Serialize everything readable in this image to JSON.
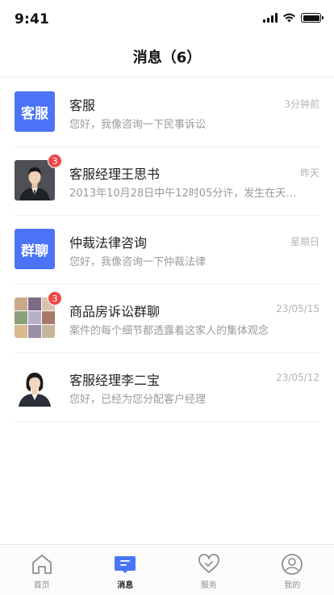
{
  "status_bar": {
    "time": "9:41"
  },
  "header": {
    "title": "消息（6）"
  },
  "messages": [
    {
      "name": "客服",
      "time": "3分钟前",
      "preview": "您好，我像咨询一下民事诉讼",
      "avatar_text": "客服",
      "badge": ""
    },
    {
      "name": "客服经理王思书",
      "time": "昨天",
      "preview": "2013年10月28日中午12时05分许，发生在天…",
      "avatar_text": "",
      "badge": "3"
    },
    {
      "name": "仲裁法律咨询",
      "time": "星期日",
      "preview": "您好，我像咨询一下仲裁法律",
      "avatar_text": "群聊",
      "badge": ""
    },
    {
      "name": "商品房诉讼群聊",
      "time": "23/05/15",
      "preview": "案件的每个细节都透露着这家人的集体观念",
      "avatar_text": "",
      "badge": "3"
    },
    {
      "name": "客服经理李二宝",
      "time": "23/05/12",
      "preview": "您好，已经为您分配客户经理",
      "avatar_text": "",
      "badge": ""
    }
  ],
  "tabs": [
    {
      "label": "首页",
      "icon": "home-icon"
    },
    {
      "label": "消息",
      "icon": "message-icon",
      "active": true
    },
    {
      "label": "服务",
      "icon": "heart-icon"
    },
    {
      "label": "我的",
      "icon": "profile-icon"
    }
  ],
  "colors": {
    "accent": "#4a74f5",
    "badge": "#f04848"
  }
}
